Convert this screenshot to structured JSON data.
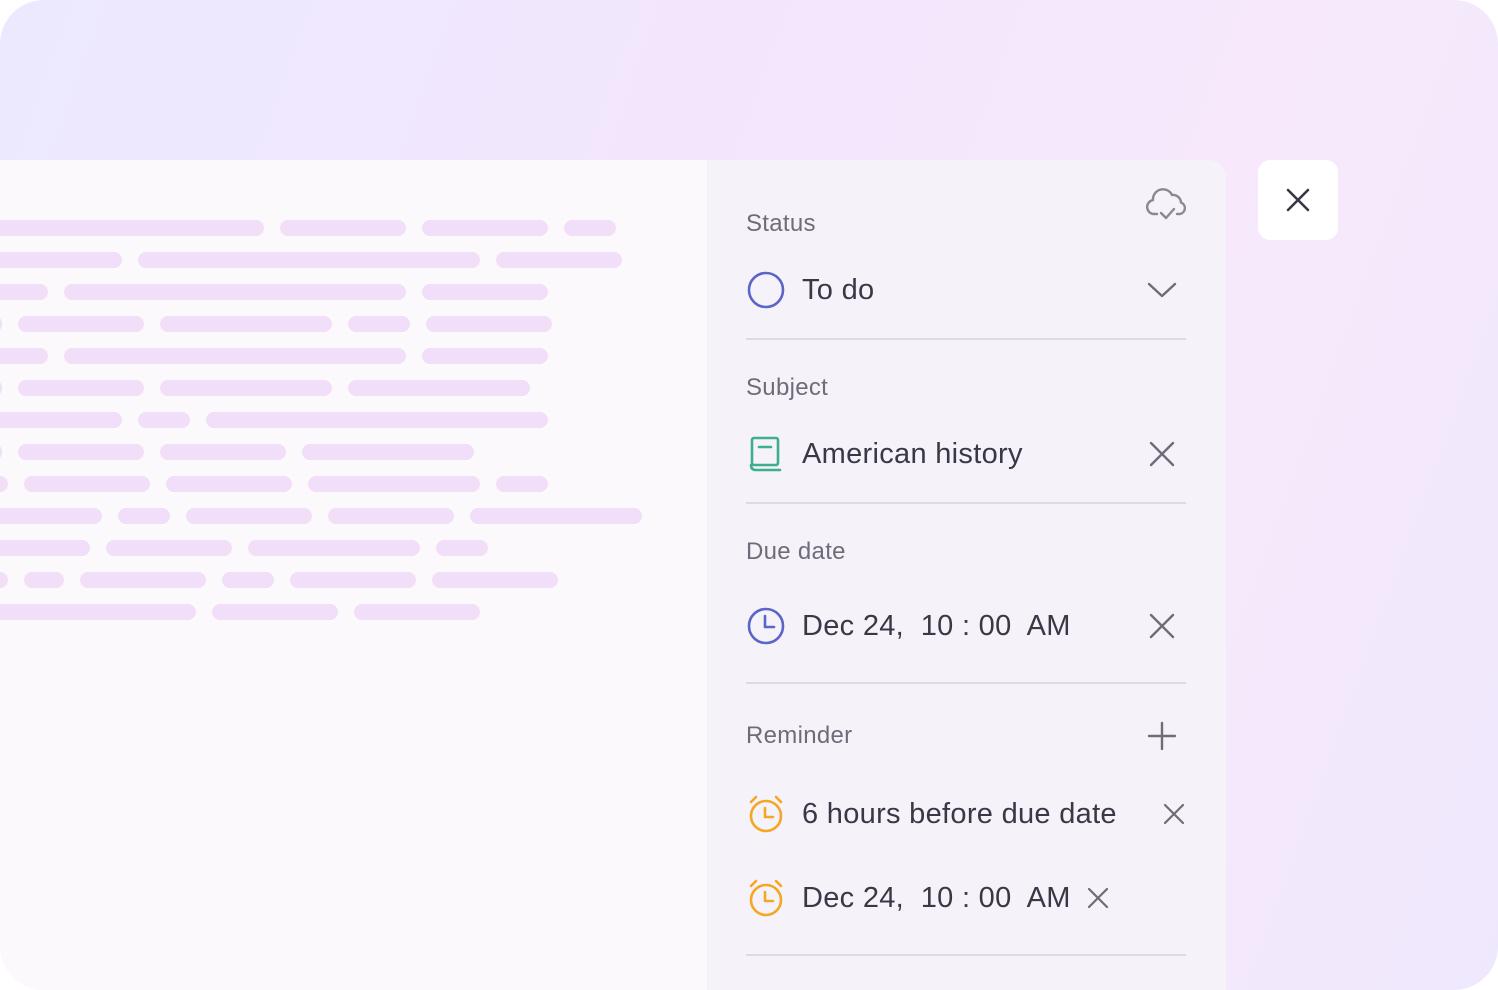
{
  "panel": {
    "status": {
      "label": "Status",
      "value": "To do"
    },
    "subject": {
      "label": "Subject",
      "value": "American history"
    },
    "due_date": {
      "label": "Due date",
      "value": "Dec 24,  10 : 00  AM"
    },
    "reminder": {
      "label": "Reminder",
      "items": [
        {
          "value": "6 hours before due date"
        },
        {
          "value": "Dec 24,  10 : 00  AM"
        }
      ]
    }
  },
  "colors": {
    "status_ring": "#5b64c8",
    "subject_icon": "#3fae8f",
    "clock": "#5b64c8",
    "alarm": "#f5a623",
    "placeholder_line": "#f1def8"
  },
  "icons": {
    "sync": "cloud-check-icon",
    "close": "close-icon",
    "status": "circle-icon",
    "subject": "book-icon",
    "due": "clock-icon",
    "reminder": "alarm-clock-icon",
    "add": "plus-icon",
    "dropdown": "chevron-down-icon"
  }
}
